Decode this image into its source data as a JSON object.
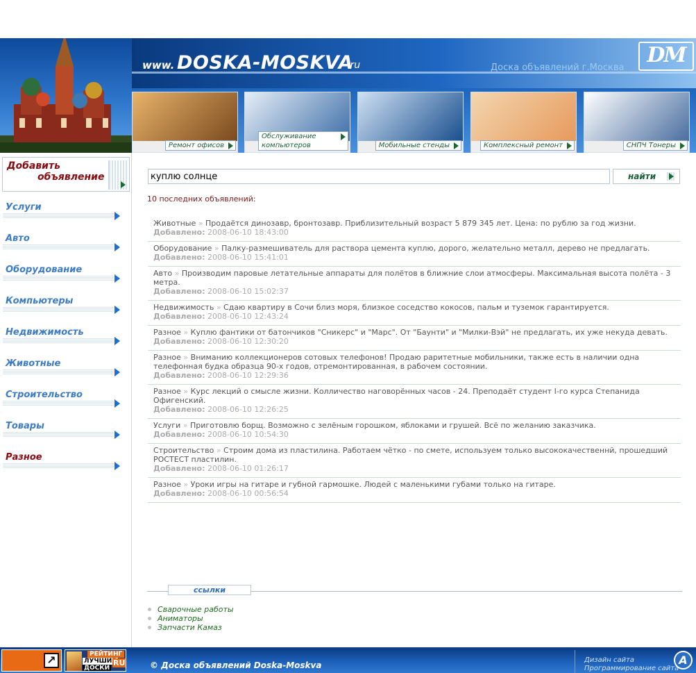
{
  "header": {
    "www": "www.",
    "site_name": "DOSKA-MOSKVA",
    "tld": ".ru",
    "tagline": "Доска объявлений г.Москва",
    "logo": "DM",
    "banners": [
      {
        "label": "Ремонт офисов",
        "colors": [
          "#e8b36a",
          "#7a4a1e"
        ]
      },
      {
        "label": "Обслуживание компьютеров",
        "colors": [
          "#e6eef7",
          "#3e6fa8"
        ]
      },
      {
        "label": "Мобильные стенды",
        "colors": [
          "#cfe0f2",
          "#1a4f8f"
        ]
      },
      {
        "label": "Комплексный ремонт",
        "colors": [
          "#f3d6b0",
          "#e79a5c"
        ]
      },
      {
        "label": "СНПЧ Тонеры",
        "colors": [
          "#ffffff",
          "#4a6ea0"
        ]
      }
    ]
  },
  "sidebar": {
    "add_line1": "Добавить",
    "add_line2": "объявление",
    "categories": [
      {
        "label": "Услуги",
        "active": false
      },
      {
        "label": "Авто",
        "active": false
      },
      {
        "label": "Оборудование",
        "active": false
      },
      {
        "label": "Компьютеры",
        "active": false
      },
      {
        "label": "Недвижимость",
        "active": false
      },
      {
        "label": "Животные",
        "active": false
      },
      {
        "label": "Строительство",
        "active": false
      },
      {
        "label": "Товары",
        "active": false
      },
      {
        "label": "Разное",
        "active": true
      }
    ]
  },
  "search": {
    "value": "куплю солнце",
    "button_label": "найти"
  },
  "recent_heading": "10 последних объявлений:",
  "ads": [
    {
      "category": "Животные",
      "text": "Продаётся динозавр, бронтозавр. Приблизительный возраст 5 879 345 лет. Цена: по рублю за год жизни.",
      "date": "2008-06-10 18:43:00"
    },
    {
      "category": "Оборудование",
      "text": "Палку-размешиватель для раствора цемента куплю, дорого, желательно металл, дерево не предлагать.",
      "date": "2008-06-10 15:41:01"
    },
    {
      "category": "Авто",
      "text": "Производим паровые летательные аппараты для полётов в ближние слои атмосферы. Максимальная высота полёта - 3 метра.",
      "date": "2008-06-10 15:02:37"
    },
    {
      "category": "Недвижимость",
      "text": "Сдаю квартиру в Сочи близ моря, близкое соседство кокосов, пальм и туземок гарантируется.",
      "date": "2008-06-10 12:43:24"
    },
    {
      "category": "Разное",
      "text": "Куплю фантики от батончиков \"Сникерс\" и \"Марс\". От \"Баунти\" и \"Милки-Вэй\" не предлагать, их уже некуда девать.",
      "date": "2008-06-10 12:30:20"
    },
    {
      "category": "Разное",
      "text": "Вниманию коллекционеров сотовых телефонов! Продаю раритетные мобильники, также есть в наличии одна телефонная будка образца 90-х годов, отремонтированная, в рабочем состоянии.",
      "date": "2008-06-10 12:29:36"
    },
    {
      "category": "Разное",
      "text": "Курс лекций о смысле жизни. Колличество наговорённых часов - 24. Преподаёт студент I-го курса Степанида Офигенский.",
      "date": "2008-06-10 12:26:25"
    },
    {
      "category": "Услуги",
      "text": "Приготовлю борщ. Возможно с зелёным горошком, яблоками и грушей. Всё по желанию заказчика.",
      "date": "2008-06-10 10:54:30"
    },
    {
      "category": "Строительство",
      "text": "Строим дома из пластилина. Работаем чётко - по смете, используем только высококачественнй, прошедший РОСТЕСТ пластилин.",
      "date": "2008-06-10 01:26:17"
    },
    {
      "category": "Разное",
      "text": "Уроки игры на гитаре и губной гармошке. Людей с маленькими губами только на гитаре.",
      "date": "2008-06-10 00:56:54"
    }
  ],
  "ad_date_label": "Добавлено:",
  "ad_separator": "»",
  "links_title": "ссылки",
  "links": [
    "Сварочные работы",
    "Аниматоры",
    "Запчасти Камаз"
  ],
  "footer": {
    "counter_line1": "РЕЙТИНГ",
    "counter_line2": "ЛУЧШИЕ",
    "counter_line3": "ДОСКИ",
    "counter_tld": "RU",
    "copyright": "© Доска объявлений Doska-Moskva",
    "design_line1": "Дизайн сайта",
    "design_line2": "Программирование сайта"
  }
}
